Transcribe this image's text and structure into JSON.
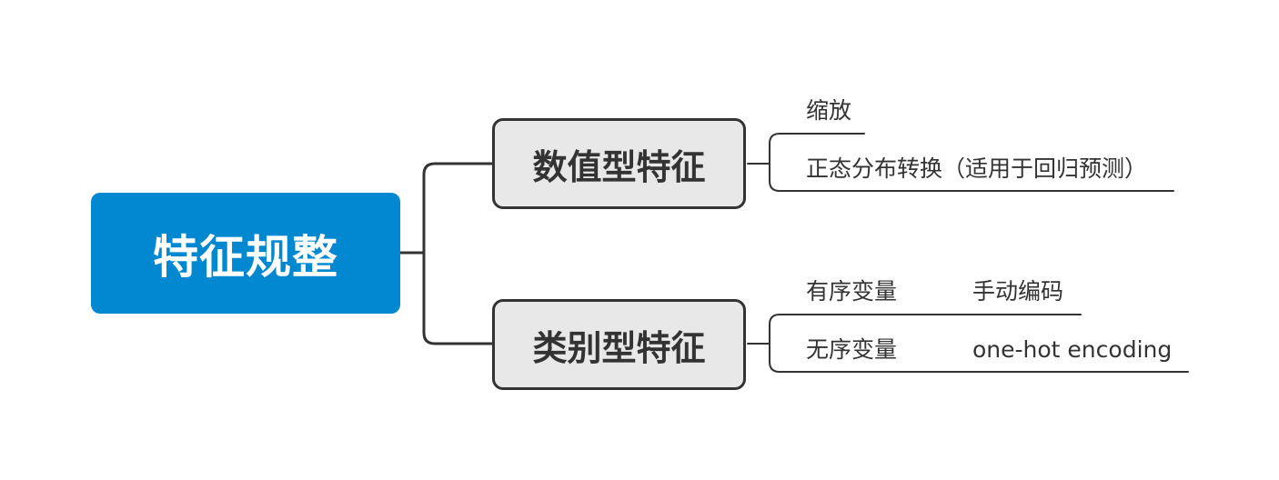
{
  "root": {
    "label": "特征规整",
    "color": "#0288d1"
  },
  "branches": [
    {
      "label": "数值型特征",
      "children": [
        {
          "label": "缩放"
        },
        {
          "label": "正态分布转换（适用于回归预测）"
        }
      ]
    },
    {
      "label": "类别型特征",
      "children": [
        {
          "label": "有序变量",
          "detail": "手动编码"
        },
        {
          "label": "无序变量",
          "detail": "one-hot encoding"
        }
      ]
    }
  ]
}
